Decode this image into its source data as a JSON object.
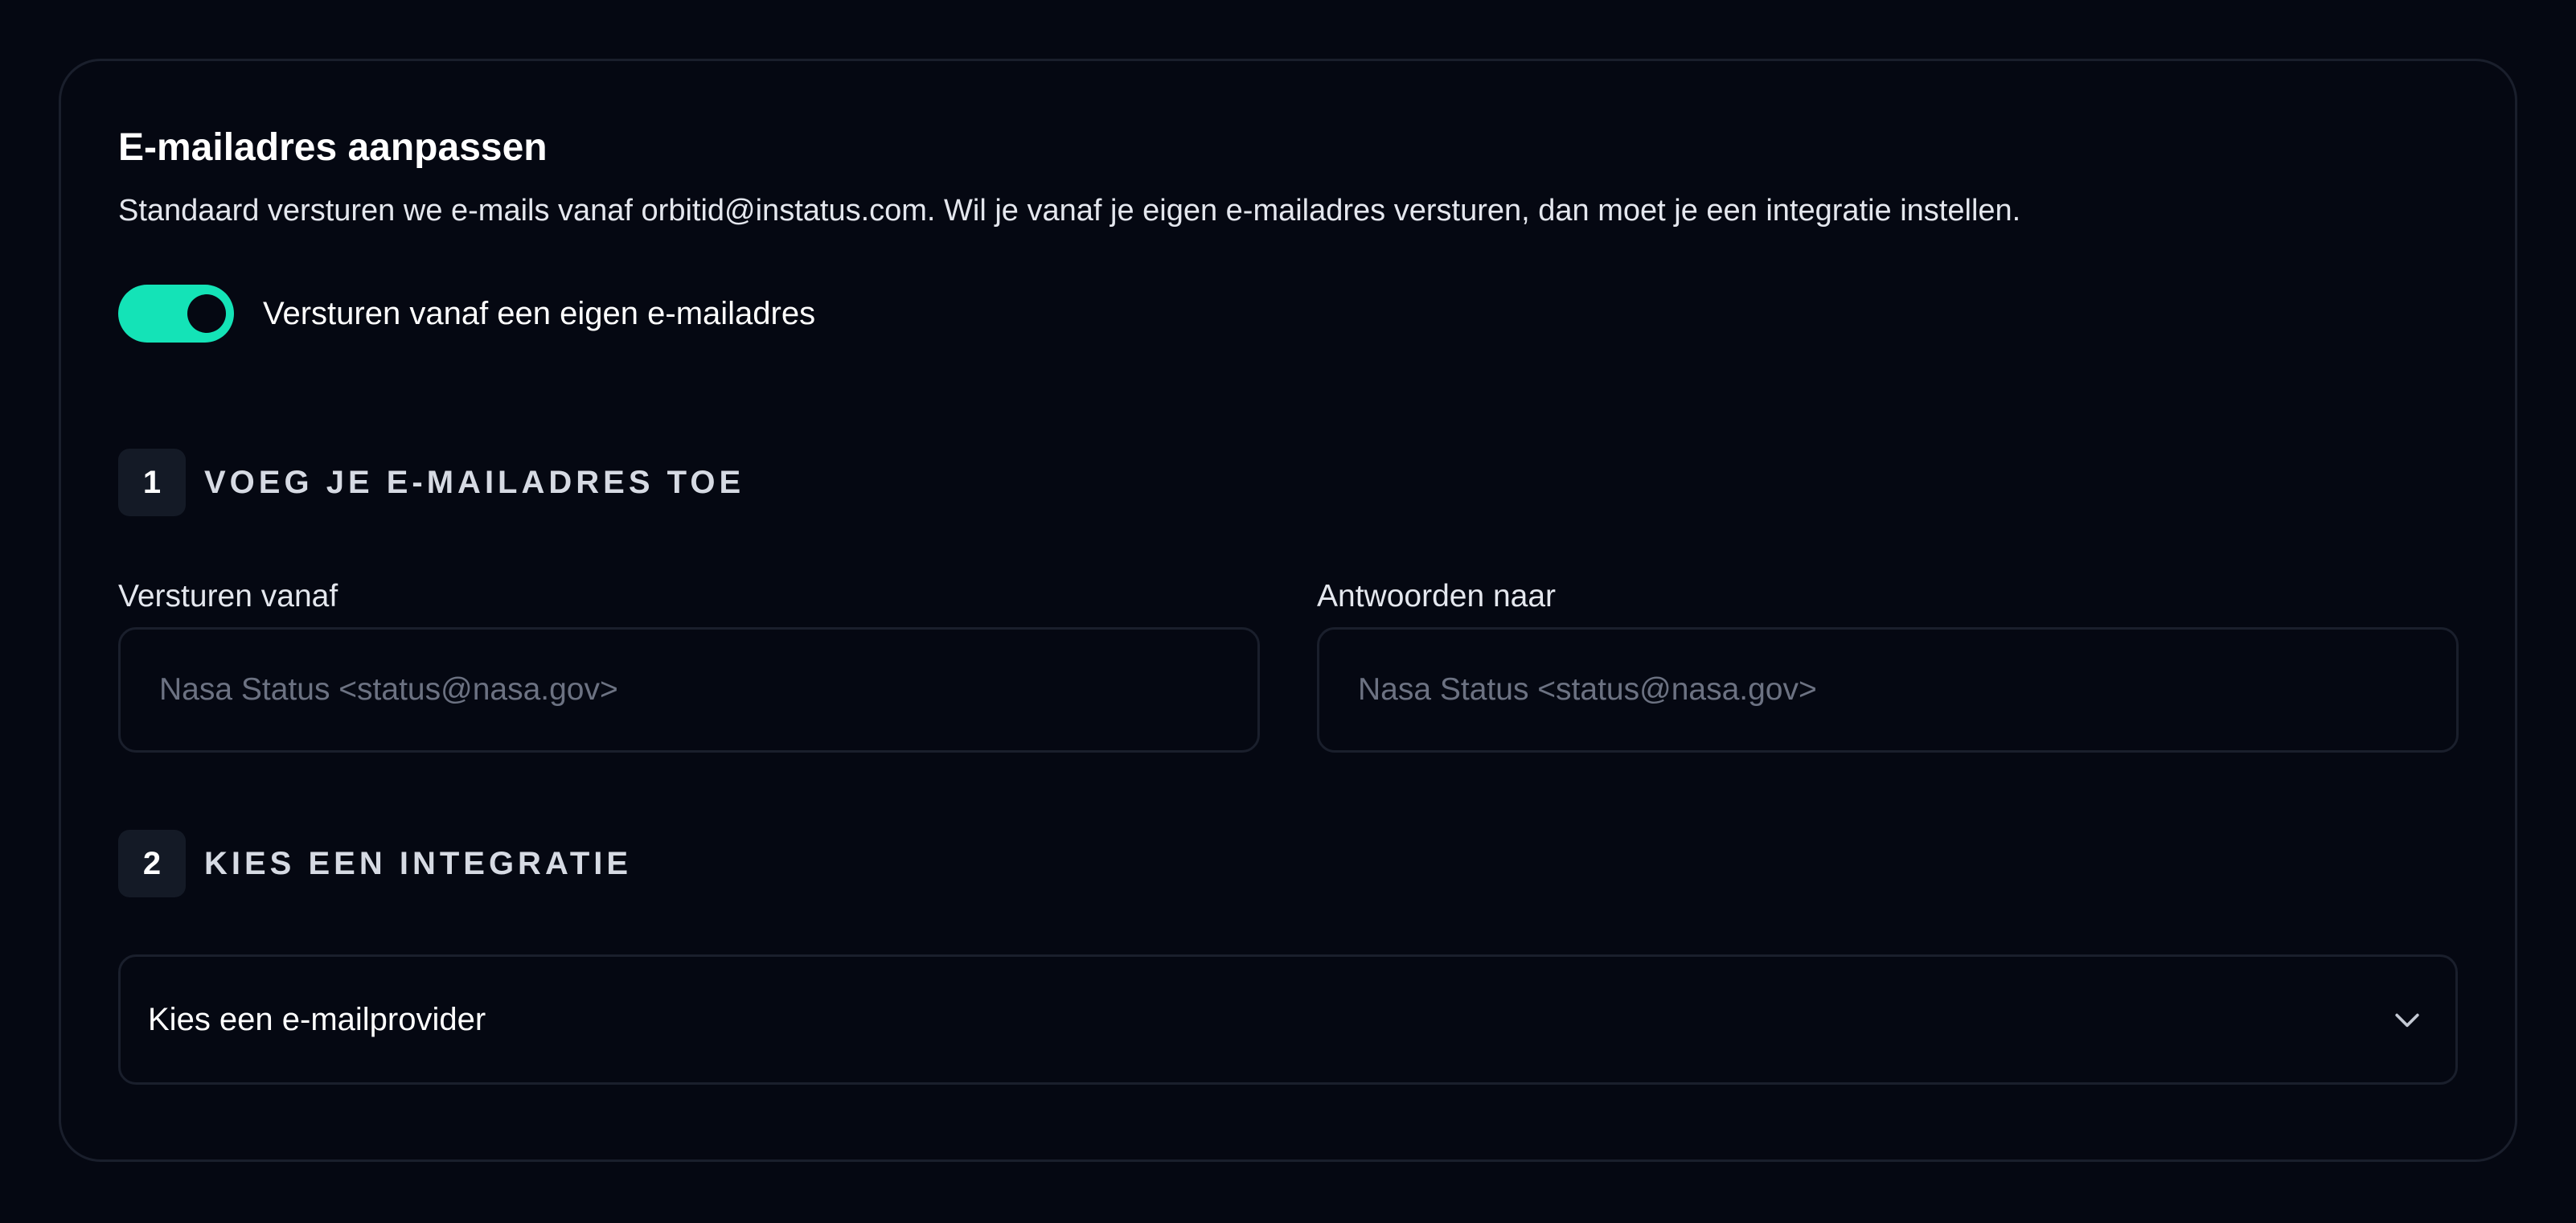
{
  "section": {
    "title": "E-mailadres aanpassen",
    "description": "Standaard versturen we e-mails vanaf orbitid@instatus.com. Wil je vanaf je eigen e-mailadres versturen, dan moet je een integratie instellen."
  },
  "toggle": {
    "label": "Versturen vanaf een eigen e-mailadres",
    "checked": true,
    "color": "#14e3b7"
  },
  "step1": {
    "number": "1",
    "title": "VOEG JE E-MAILADRES TOE",
    "from_label": "Versturen vanaf",
    "from_placeholder": "Nasa Status <status@nasa.gov>",
    "reply_label": "Antwoorden naar",
    "reply_placeholder": "Nasa Status <status@nasa.gov>"
  },
  "step2": {
    "number": "2",
    "title": "KIES EEN INTEGRATIE",
    "select_value": "Kies een e-mailprovider",
    "select_icon": "chevron-down-icon"
  }
}
